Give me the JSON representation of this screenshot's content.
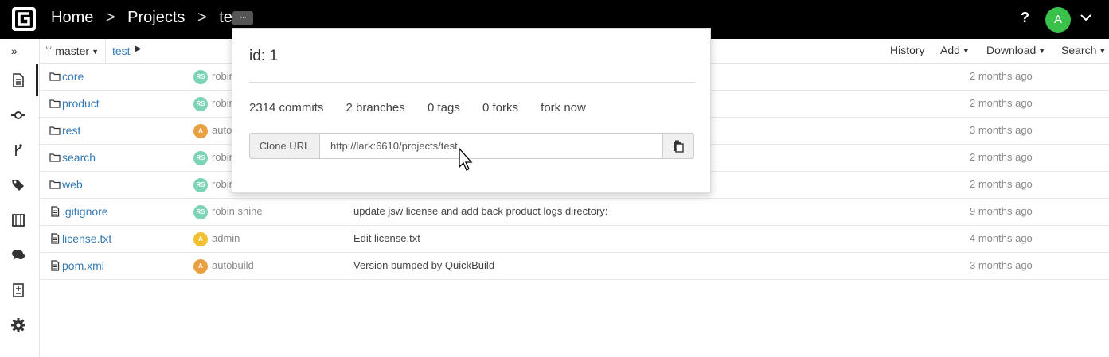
{
  "topbar": {
    "breadcrumbs": [
      "Home",
      "Projects",
      "test"
    ],
    "separator": ">",
    "more_label": "···",
    "help_label": "?",
    "user_initial": "A",
    "user_avatar_color": "#3ac14b"
  },
  "toolbar": {
    "branch": "master",
    "path": "test",
    "history_label": "History",
    "add_label": "Add",
    "download_label": "Download",
    "search_label": "Search"
  },
  "sidebar": {
    "icons": [
      "files-icon",
      "commits-icon",
      "branches-icon",
      "tags-icon",
      "pull-requests-icon",
      "comments-icon",
      "compare-icon",
      "settings-icon"
    ]
  },
  "files": [
    {
      "type": "folder",
      "name": "core",
      "avatar": "RS",
      "avatar_color": "#7dd3b5",
      "author": "robin shine",
      "message": "",
      "age": "2 months ago"
    },
    {
      "type": "folder",
      "name": "product",
      "avatar": "RS",
      "avatar_color": "#7dd3b5",
      "author": "robin shine",
      "message": "",
      "age": "2 months ago"
    },
    {
      "type": "folder",
      "name": "rest",
      "avatar": "A",
      "avatar_color": "#e8a042",
      "author": "autobuild",
      "message": "",
      "age": "3 months ago"
    },
    {
      "type": "folder",
      "name": "search",
      "avatar": "RS",
      "avatar_color": "#7dd3b5",
      "author": "robin shine",
      "message": "",
      "age": "2 months ago"
    },
    {
      "type": "folder",
      "name": "web",
      "avatar": "RS",
      "avatar_color": "#7dd3b5",
      "author": "robin shine",
      "message": "",
      "age": "2 months ago"
    },
    {
      "type": "file",
      "name": ".gitignore",
      "avatar": "RS",
      "avatar_color": "#7dd3b5",
      "author": "robin shine",
      "message": "update jsw license and add back product logs directory:",
      "age": "9 months ago"
    },
    {
      "type": "file",
      "name": "license.txt",
      "avatar": "A",
      "avatar_color": "#f0c030",
      "author": "admin",
      "message": "Edit license.txt",
      "age": "4 months ago"
    },
    {
      "type": "file",
      "name": "pom.xml",
      "avatar": "A",
      "avatar_color": "#e8a042",
      "author": "autobuild",
      "message": "Version bumped by QuickBuild",
      "age": "3 months ago"
    }
  ],
  "popover": {
    "id_label": "id: 1",
    "commits": "2314 commits",
    "branches": "2 branches",
    "tags": "0 tags",
    "forks": "0 forks",
    "fork_now": "fork now",
    "clone_label": "Clone URL",
    "clone_url": "http://lark:6610/projects/test"
  }
}
